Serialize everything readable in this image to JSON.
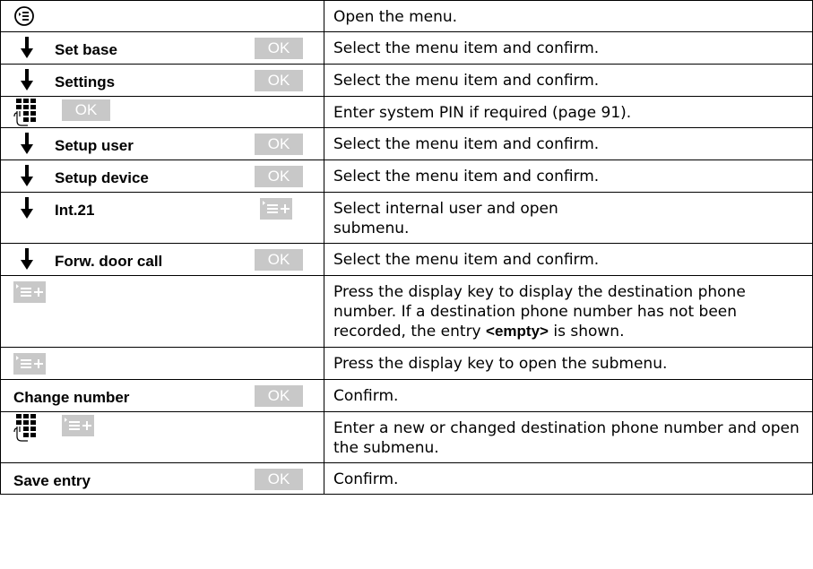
{
  "rows": [
    {
      "key": "nav",
      "label": "",
      "action": "",
      "desc": "Open the menu."
    },
    {
      "key": "arrow",
      "label": "Set base",
      "action": "OK",
      "desc": "Select the menu item and confirm."
    },
    {
      "key": "arrow",
      "label": "Settings",
      "action": "OK",
      "desc": "Select the menu item and confirm."
    },
    {
      "key": "keypad",
      "label": "",
      "action": "OK",
      "desc": "Enter system PIN if required (page 91)."
    },
    {
      "key": "arrow",
      "label": "Setup user",
      "action": "OK",
      "desc": "Select the menu item and confirm."
    },
    {
      "key": "arrow",
      "label": "Setup device",
      "action": "OK",
      "desc": "Select the menu item and confirm."
    },
    {
      "key": "arrow",
      "label": "Int.21",
      "action": "menu",
      "desc": "Select internal user and open\nsubmenu."
    },
    {
      "key": "arrow",
      "label": "Forw. door call",
      "action": "OK",
      "desc": "Select the menu item and confirm."
    },
    {
      "key": "none",
      "label": "",
      "action": "menu",
      "desc_parts": [
        "Press the display key to display the destination phone number. If a destination phone number has not been recorded, the entry ",
        "<empty>",
        " is shown."
      ]
    },
    {
      "key": "none",
      "label": "",
      "action": "menu",
      "desc": "Press the display key to open the submenu."
    },
    {
      "key": "none",
      "label": "Change number",
      "action": "OK",
      "desc": "Confirm."
    },
    {
      "key": "keypad",
      "label": "",
      "action": "menu",
      "desc": "Enter a new or changed destination phone number and open the submenu."
    },
    {
      "key": "none",
      "label": "Save entry",
      "action": "OK",
      "desc": "Confirm."
    }
  ],
  "colors": {
    "key_bg": "#c8c8c8",
    "key_text": "#ffffff",
    "border": "#000000"
  },
  "icons": {
    "nav": "navigation-key-icon",
    "arrow": "down-arrow-icon",
    "keypad": "keypad-icon",
    "menu": "display-menu-key-icon"
  }
}
